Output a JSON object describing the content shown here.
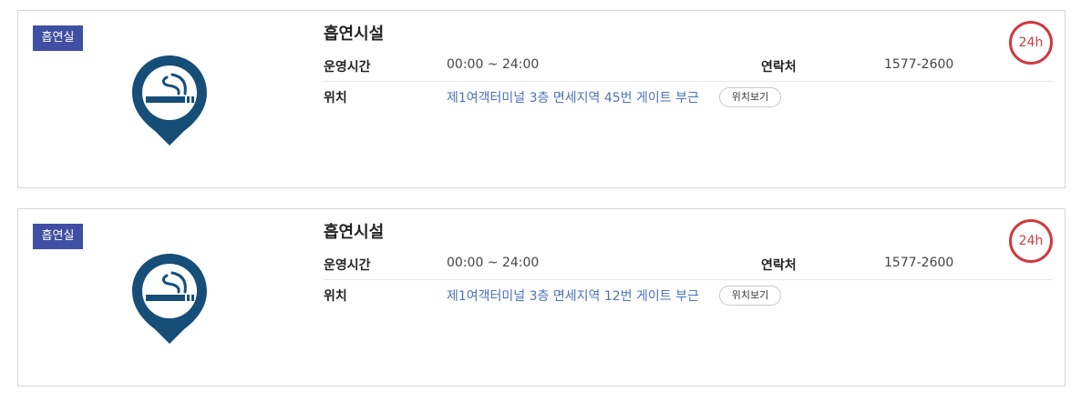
{
  "colors": {
    "badge_bg": "#3f4fa3",
    "pin_fill": "#164e78",
    "link": "#4a73b8",
    "h24_ring": "#d0393f"
  },
  "cards": [
    {
      "badge": "흡연실",
      "icon": "smoking-pin-icon",
      "title": "흡연시설",
      "hours_label": "운영시간",
      "hours_value": "00:00 ~ 24:00",
      "contact_label": "연락처",
      "contact_value": "1577-2600",
      "location_label": "위치",
      "location_value": "제1여객터미널 3층 면세지역 45번 게이트 부근",
      "view_button": "위치보기",
      "h24": "24h"
    },
    {
      "badge": "흡연실",
      "icon": "smoking-pin-icon",
      "title": "흡연시설",
      "hours_label": "운영시간",
      "hours_value": "00:00 ~ 24:00",
      "contact_label": "연락처",
      "contact_value": "1577-2600",
      "location_label": "위치",
      "location_value": "제1여객터미널 3층 면세지역 12번 게이트 부근",
      "view_button": "위치보기",
      "h24": "24h"
    }
  ]
}
